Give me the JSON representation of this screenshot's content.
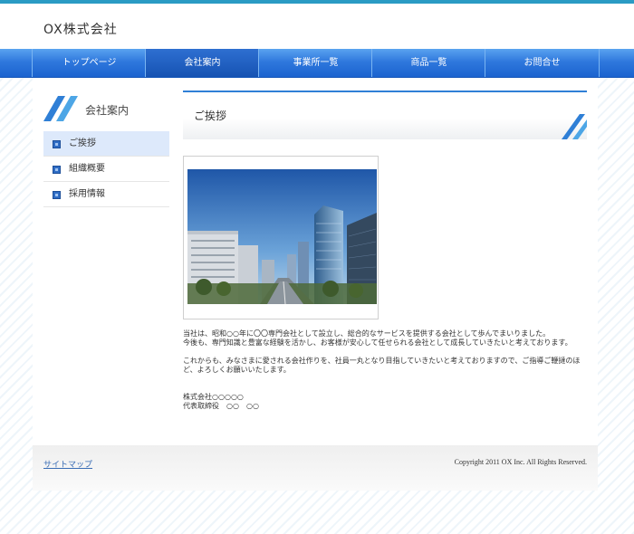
{
  "header": {
    "company_name": "OX株式会社"
  },
  "global_nav": {
    "items": [
      {
        "label": "トップページ"
      },
      {
        "label": "会社案内"
      },
      {
        "label": "事業所一覧"
      },
      {
        "label": "商品一覧"
      },
      {
        "label": "お問合せ"
      }
    ],
    "active_index": 1
  },
  "sidebar": {
    "title": "会社案内",
    "items": [
      {
        "label": "ご挨拶"
      },
      {
        "label": "組織概要"
      },
      {
        "label": "採用情報"
      }
    ],
    "active_index": 0
  },
  "main": {
    "heading": "ご挨拶",
    "paragraph1": [
      "当社は、昭和○○年に〇〇専門会社として設立し、総合的なサービスを提供する会社として歩んでまいりました。",
      "今後も、専門知識と豊富な経験を活かし、お客様が安心して任せられる会社として成長していきたいと考えております。"
    ],
    "paragraph2": [
      "これからも、みなさまに愛される会社作りを、社員一丸となり目指していきたいと考えておりますので、ご指導ご鞭撻のほ",
      "ど、よろしくお願いいたします。"
    ],
    "signature": [
      "株式会社○○○○○",
      "代表取締役　○○　○○"
    ]
  },
  "footer": {
    "sitemap_label": "サイトマップ",
    "copyright": "Copyright 2011 OX Inc. All Rights Reserved."
  },
  "colors": {
    "accent_blue": "#2f7fd6",
    "nav_blue": "#2f78dd",
    "top_line": "#2a9bc4"
  }
}
